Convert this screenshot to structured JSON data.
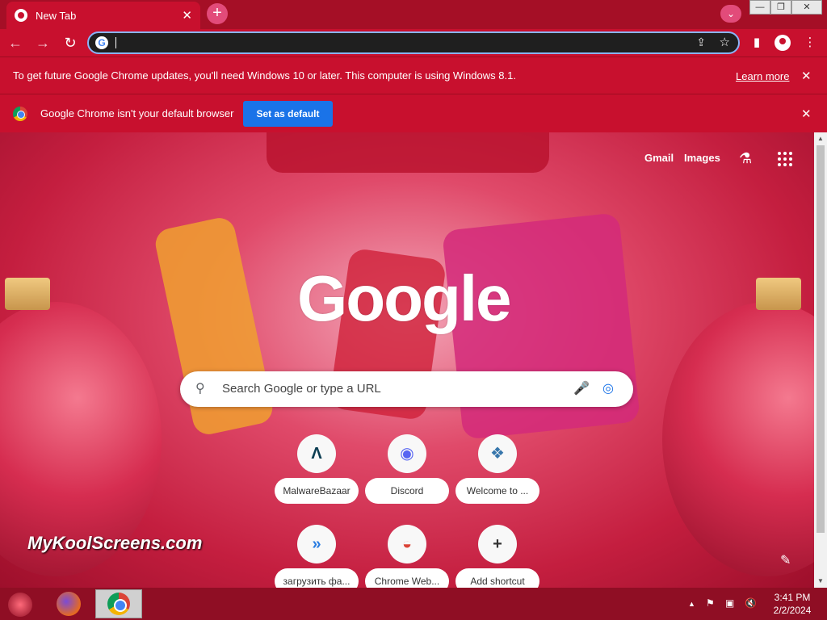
{
  "window": {
    "tab_title": "New Tab",
    "tab_close": "✕",
    "new_tab": "+",
    "tab_search": "⌄",
    "minimize": "—",
    "restore": "❐",
    "close": "✕"
  },
  "toolbar": {
    "back": "←",
    "forward": "→",
    "reload": "↻",
    "address_value": "",
    "share_icon": "⇪",
    "star_icon": "☆",
    "side_panel_icon": "▮",
    "menu_icon": "⋮"
  },
  "infobars": {
    "update_message": "To get future Google Chrome updates, you'll need Windows 10 or later. This computer is using Windows 8.1.",
    "learn_more": "Learn more",
    "default_message": "Google Chrome isn't your default browser",
    "set_default": "Set as default",
    "close": "✕"
  },
  "ntp": {
    "gmail": "Gmail",
    "images": "Images",
    "logo": "Google",
    "search_placeholder": "Search Google or type a URL",
    "watermark": "MyKoolScreens.com",
    "shortcuts": [
      {
        "label": "MalwareBazaar",
        "glyph": "Λ",
        "color": "#0b3d52"
      },
      {
        "label": "Discord",
        "glyph": "◉",
        "color": "#5865f2"
      },
      {
        "label": "Welcome to ...",
        "glyph": "❖",
        "color": "#3776ab"
      },
      {
        "label": "загрузить фа...",
        "glyph": "»",
        "color": "#2a7de1"
      },
      {
        "label": "Chrome Web...",
        "glyph": "◒",
        "color": "#db4437"
      },
      {
        "label": "Add shortcut",
        "glyph": "+",
        "color": "#333333"
      }
    ]
  },
  "taskbar": {
    "time": "3:41 PM",
    "date": "2/2/2024",
    "tray_up": "▲",
    "flag": "⚑",
    "network": "▣",
    "volume": "🔇"
  }
}
